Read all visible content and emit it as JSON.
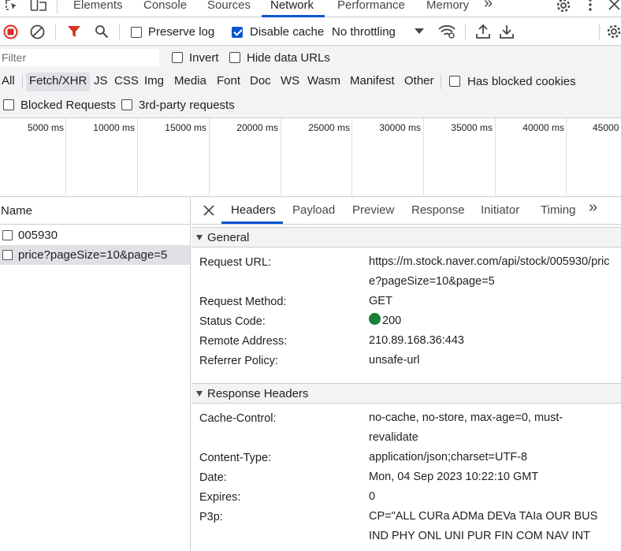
{
  "tabs": [
    {
      "label": "Elements"
    },
    {
      "label": "Console"
    },
    {
      "label": "Sources"
    },
    {
      "label": "Network"
    },
    {
      "label": "Performance"
    },
    {
      "label": "Memory"
    }
  ],
  "more_tabs": "»",
  "toolbar": {
    "preserve_log": {
      "label": "Preserve log",
      "checked": false
    },
    "disable_cache": {
      "label": "Disable cache",
      "checked": true
    },
    "throttling": "No throttling"
  },
  "filter": {
    "placeholder": "Filter",
    "invert": "Invert",
    "hide_data_urls": "Hide data URLs",
    "types": [
      "All",
      "Fetch/XHR",
      "JS",
      "CSS",
      "Img",
      "Media",
      "Font",
      "Doc",
      "WS",
      "Wasm",
      "Manifest",
      "Other"
    ],
    "active_type": "Fetch/XHR",
    "has_blocked_cookies": "Has blocked cookies",
    "blocked_requests": "Blocked Requests",
    "third_party": "3rd-party requests"
  },
  "timeline": {
    "ticks": [
      "5000 ms",
      "10000 ms",
      "15000 ms",
      "20000 ms",
      "25000 ms",
      "30000 ms",
      "35000 ms",
      "40000 ms",
      "45000"
    ]
  },
  "requests": {
    "header": "Name",
    "rows": [
      {
        "name": "005930",
        "selected": false
      },
      {
        "name": "price?pageSize=10&page=5",
        "selected": true
      }
    ]
  },
  "details": {
    "tabs": [
      "Headers",
      "Payload",
      "Preview",
      "Response",
      "Initiator",
      "Timing"
    ],
    "active_tab": "Headers",
    "general": {
      "title": "General",
      "request_url_key": "Request URL:",
      "request_url": "https://m.stock.naver.com/api/stock/005930/price?pageSize=10&page=5",
      "request_method_key": "Request Method:",
      "request_method": "GET",
      "status_code_key": "Status Code:",
      "status_code": "200",
      "remote_address_key": "Remote Address:",
      "remote_address": "210.89.168.36:443",
      "referrer_policy_key": "Referrer Policy:",
      "referrer_policy": "unsafe-url"
    },
    "response_headers": {
      "title": "Response Headers",
      "cache_control_key": "Cache-Control:",
      "cache_control": "no-cache, no-store, max-age=0, must-revalidate",
      "content_type_key": "Content-Type:",
      "content_type": "application/json;charset=UTF-8",
      "date_key": "Date:",
      "date": "Mon, 04 Sep 2023 10:22:10 GMT",
      "expires_key": "Expires:",
      "expires": "0",
      "p3p_key": "P3p:",
      "p3p": "CP=\"ALL CURa ADMa DEVa TAIa OUR BUS IND PHY ONL UNI PUR FIN COM NAV INT"
    }
  },
  "colors": {
    "accent": "#0b57d0",
    "record": "#d93025",
    "filter_icon": "#d93025",
    "status_ok": "#188038"
  }
}
